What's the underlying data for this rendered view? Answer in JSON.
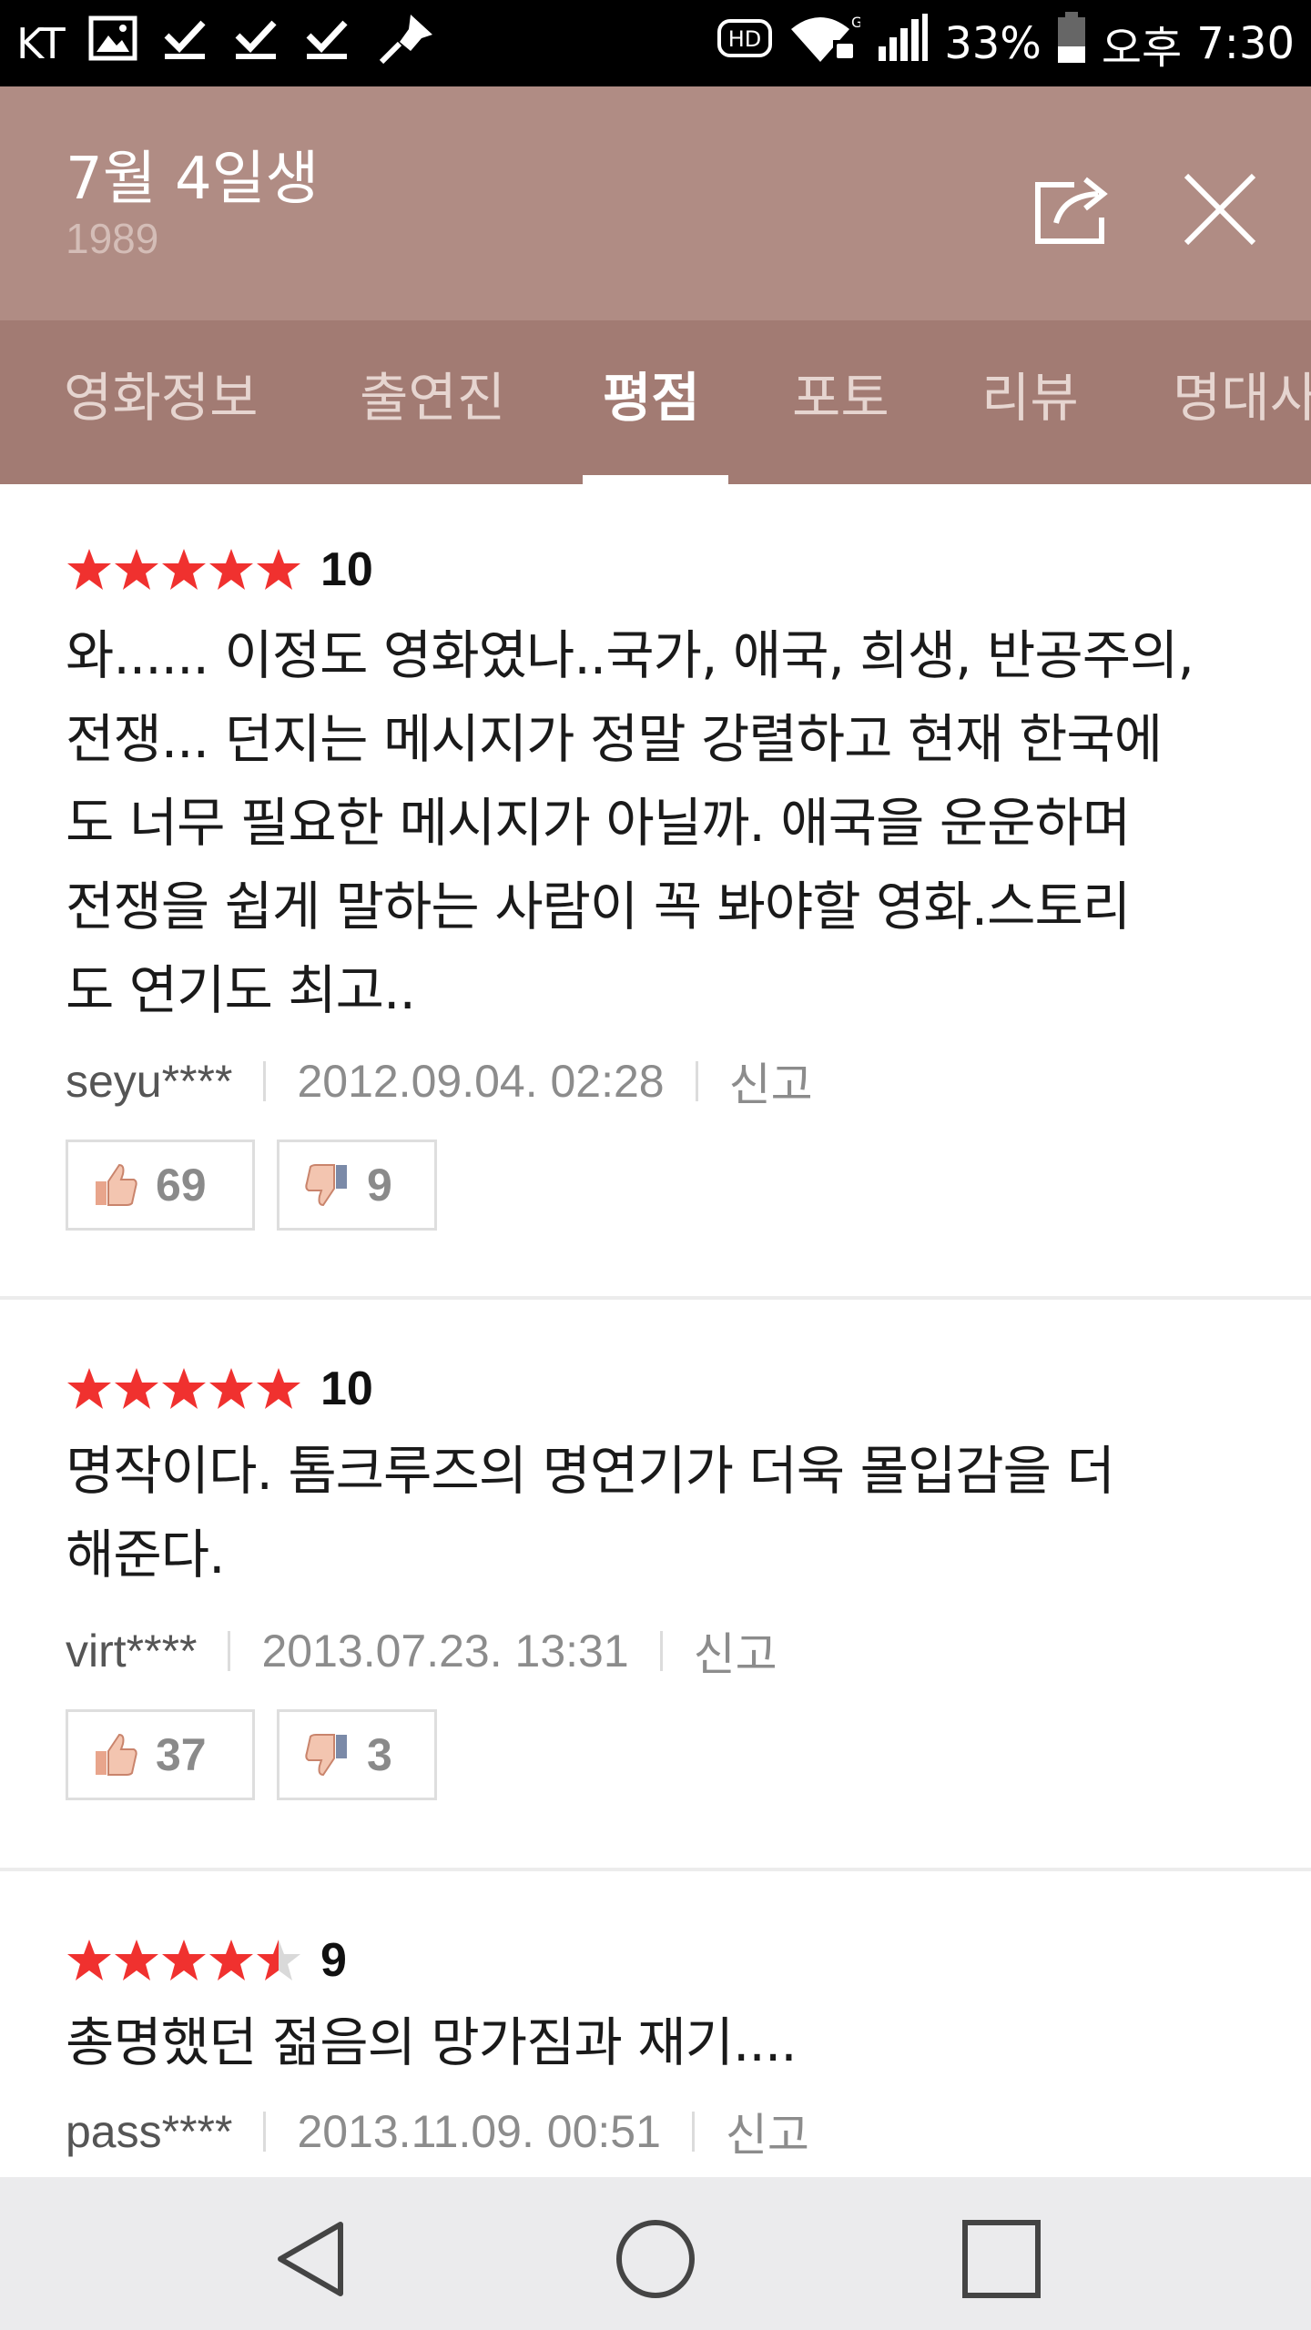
{
  "status_bar": {
    "carrier": "KT",
    "hd": "HD",
    "battery": "33%",
    "ampm": "오후",
    "time": "7:30",
    "icons": [
      "image-icon",
      "check-icon",
      "check-icon",
      "check-icon",
      "pin-icon",
      "hd-icon",
      "wifi-icon",
      "signal-icon",
      "battery-icon"
    ]
  },
  "header": {
    "title": "7월 4일생",
    "year": "1989",
    "share_icon": "share-icon",
    "close_icon": "close-icon"
  },
  "tabs": [
    {
      "label": "영화정보"
    },
    {
      "label": "출연진"
    },
    {
      "label": "평점",
      "active": true
    },
    {
      "label": "포토"
    },
    {
      "label": "리뷰"
    },
    {
      "label": "명대사"
    }
  ],
  "reviews": [
    {
      "rating_out_of_5": 5,
      "score": "10",
      "lines": [
        "와...... 이정도 영화였나..국가, 애국, 희생, 반공주의,",
        "전쟁... 던지는 메시지가 정말 강렬하고 현재 한국에",
        "도 너무 필요한 메시지가 아닐까. 애국을 운운하며",
        "전쟁을 쉽게 말하는 사람이 꼭 봐야할 영화.스토리",
        "도 연기도 최고.."
      ],
      "user": "seyu****",
      "date": "2012.09.04. 02:28",
      "report": "신고",
      "likes": "69",
      "dislikes": "9"
    },
    {
      "rating_out_of_5": 5,
      "score": "10",
      "lines": [
        "명작이다. 톰크루즈의 명연기가 더욱 몰입감을 더",
        "해준다."
      ],
      "user": "virt****",
      "date": "2013.07.23. 13:31",
      "report": "신고",
      "likes": "37",
      "dislikes": "3"
    },
    {
      "rating_out_of_5": 4.5,
      "score": "9",
      "lines": [
        "총명했던 젊음의 망가짐과 재기...."
      ],
      "user": "pass****",
      "date": "2013.11.09. 00:51",
      "report": "신고"
    }
  ],
  "colors": {
    "header": "#b08c84",
    "tabs": "#a27b73",
    "star": "#f0312f",
    "star_empty": "#d9d9d9"
  },
  "nav_bar": {
    "icons": [
      "back-icon",
      "home-icon",
      "recents-icon"
    ]
  }
}
